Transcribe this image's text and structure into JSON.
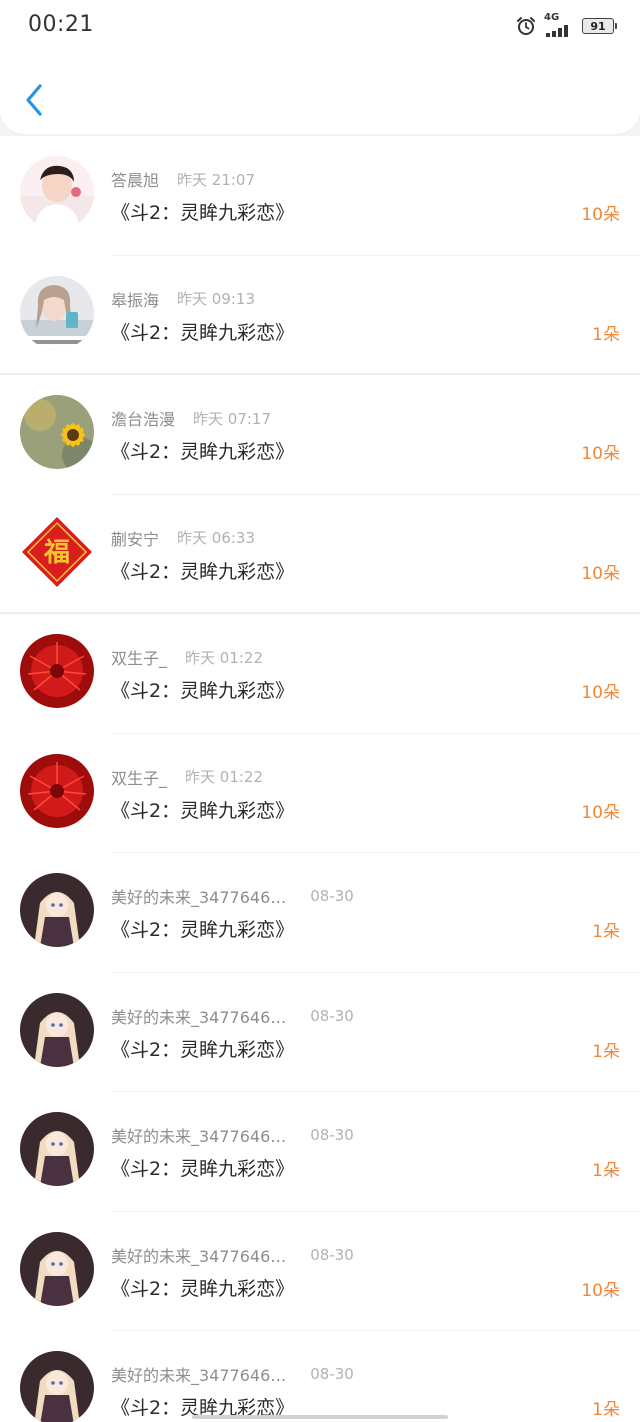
{
  "status_bar": {
    "time": "00:21",
    "network": "4G",
    "battery": "91"
  },
  "header": {
    "back_icon": "chevron-left-icon"
  },
  "colors": {
    "accent": "#f0883a",
    "back": "#2a95e3"
  },
  "items": [
    {
      "name": "答晨旭",
      "time": "昨天 21:07",
      "book": "《斗2：灵眸九彩恋》",
      "count": "10朵",
      "avatar": "person-photo"
    },
    {
      "name": "皋振海",
      "time": "昨天 09:13",
      "book": "《斗2：灵眸九彩恋》",
      "count": "1朵",
      "avatar": "girl-photo"
    },
    {
      "name": "澹台浩漫",
      "time": "昨天 07:17",
      "book": "《斗2：灵眸九彩恋》",
      "count": "10朵",
      "avatar": "sunflower"
    },
    {
      "name": "蒯安宁",
      "time": "昨天 06:33",
      "book": "《斗2：灵眸九彩恋》",
      "count": "10朵",
      "avatar": "fu-character"
    },
    {
      "name": "双生子_",
      "time": "昨天 01:22",
      "book": "《斗2：灵眸九彩恋》",
      "count": "10朵",
      "avatar": "red-spider-lily"
    },
    {
      "name": "双生子_",
      "time": "昨天 01:22",
      "book": "《斗2：灵眸九彩恋》",
      "count": "10朵",
      "avatar": "red-spider-lily"
    },
    {
      "name": "美好的未来_3477646…",
      "time": "08-30",
      "book": "《斗2：灵眸九彩恋》",
      "count": "1朵",
      "avatar": "anime-girl"
    },
    {
      "name": "美好的未来_3477646…",
      "time": "08-30",
      "book": "《斗2：灵眸九彩恋》",
      "count": "1朵",
      "avatar": "anime-girl"
    },
    {
      "name": "美好的未来_3477646…",
      "time": "08-30",
      "book": "《斗2：灵眸九彩恋》",
      "count": "1朵",
      "avatar": "anime-girl"
    },
    {
      "name": "美好的未来_3477646…",
      "time": "08-30",
      "book": "《斗2：灵眸九彩恋》",
      "count": "10朵",
      "avatar": "anime-girl"
    },
    {
      "name": "美好的未来_3477646…",
      "time": "08-30",
      "book": "《斗2：灵眸九彩恋》",
      "count": "1朵",
      "avatar": "anime-girl"
    }
  ]
}
